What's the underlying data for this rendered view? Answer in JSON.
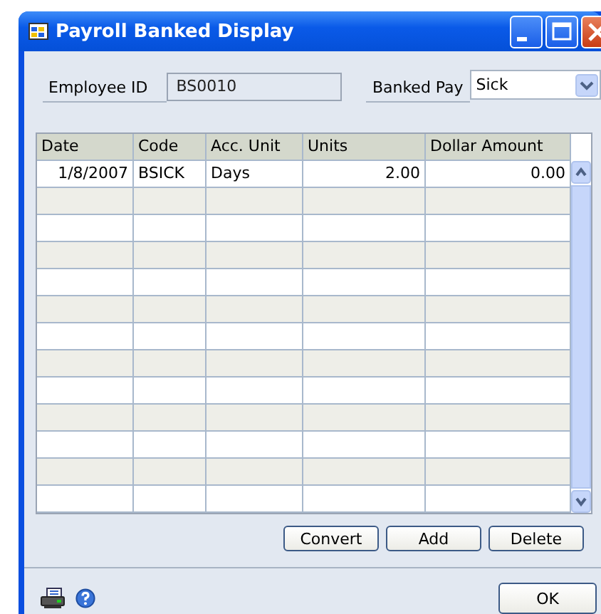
{
  "window": {
    "title": "Payroll Banked Display"
  },
  "employee_id": {
    "label": "Employee ID",
    "value": "BS0010"
  },
  "banked_pay": {
    "label": "Banked Pay",
    "value": "Sick"
  },
  "table": {
    "columns": [
      "Date",
      "Code",
      "Acc. Unit",
      "Units",
      "Dollar Amount"
    ],
    "rows": [
      [
        "1/8/2007",
        "BSICK",
        "Days",
        "2.00",
        "0.00"
      ]
    ]
  },
  "buttons": [
    "Convert",
    "Add",
    "Delete"
  ],
  "ok_button": "OK"
}
